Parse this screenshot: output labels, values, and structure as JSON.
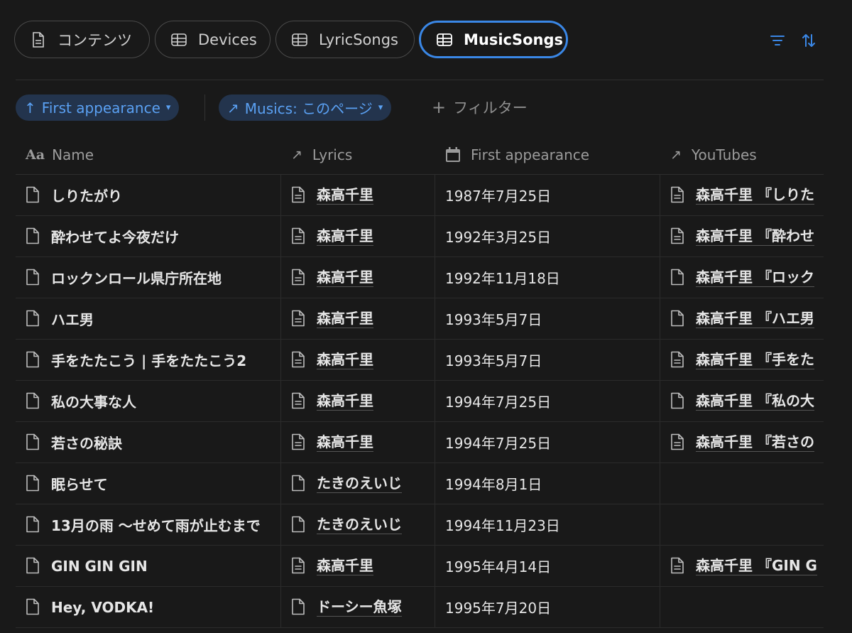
{
  "tabs": [
    {
      "label": "コンテンツ",
      "icon": "doc-icon",
      "active": false
    },
    {
      "label": "Devices",
      "icon": "table-icon",
      "active": false
    },
    {
      "label": "LyricSongs",
      "icon": "table-icon",
      "active": false
    },
    {
      "label": "MusicSongs",
      "icon": "table-icon",
      "active": true
    }
  ],
  "filters": {
    "sort_chip": {
      "arrow": "↑",
      "label": "First appearance"
    },
    "relation_chip": {
      "arrow": "↗",
      "label": "Musics: このページ"
    },
    "add_filter": {
      "plus": "+",
      "label": "フィルター"
    }
  },
  "columns": [
    {
      "label": "Name",
      "icon": "Aa"
    },
    {
      "label": "Lyrics",
      "icon": "↗"
    },
    {
      "label": "First appearance",
      "icon": "calendar-icon"
    },
    {
      "label": "YouTubes",
      "icon": "↗"
    }
  ],
  "rows": [
    {
      "name": "しりたがり",
      "lyrics": "森高千里",
      "lyrics_icon": "doc-lines",
      "date": "1987年7月25日",
      "youtube": "森高千里 『しりた",
      "yt_icon": "doc-lines"
    },
    {
      "name": "酔わせてよ今夜だけ",
      "lyrics": "森高千里",
      "lyrics_icon": "doc-lines",
      "date": "1992年3月25日",
      "youtube": "森高千里 『酔わせ",
      "yt_icon": "doc-lines"
    },
    {
      "name": "ロックンロール県庁所在地",
      "lyrics": "森高千里",
      "lyrics_icon": "doc-lines",
      "date": "1992年11月18日",
      "youtube": "森高千里 『ロック",
      "yt_icon": "doc-blank"
    },
    {
      "name": "ハエ男",
      "lyrics": "森高千里",
      "lyrics_icon": "doc-lines",
      "date": "1993年5月7日",
      "youtube": "森高千里 『ハエ男",
      "yt_icon": "doc-blank"
    },
    {
      "name": "手をたたこう | 手をたたこう2",
      "lyrics": "森高千里",
      "lyrics_icon": "doc-lines",
      "date": "1993年5月7日",
      "youtube": "森高千里 『手をた",
      "yt_icon": "doc-lines"
    },
    {
      "name": "私の大事な人",
      "lyrics": "森高千里",
      "lyrics_icon": "doc-lines",
      "date": "1994年7月25日",
      "youtube": "森高千里 『私の大",
      "yt_icon": "doc-blank"
    },
    {
      "name": "若さの秘訣",
      "lyrics": "森高千里",
      "lyrics_icon": "doc-lines",
      "date": "1994年7月25日",
      "youtube": "森高千里 『若さの",
      "yt_icon": "doc-lines"
    },
    {
      "name": "眠らせて",
      "lyrics": "たきのえいじ",
      "lyrics_icon": "doc-blank",
      "date": "1994年8月1日",
      "youtube": "",
      "yt_icon": ""
    },
    {
      "name": "13月の雨 〜せめて雨が止むまで",
      "lyrics": "たきのえいじ",
      "lyrics_icon": "doc-blank",
      "date": "1994年11月23日",
      "youtube": "",
      "yt_icon": ""
    },
    {
      "name": "GIN GIN GIN",
      "lyrics": "森高千里",
      "lyrics_icon": "doc-lines",
      "date": "1995年4月14日",
      "youtube": "森高千里 『GIN G",
      "yt_icon": "doc-lines"
    },
    {
      "name": "Hey, VODKA!",
      "lyrics": "ドーシー魚塚",
      "lyrics_icon": "doc-blank",
      "date": "1995年7月20日",
      "youtube": "",
      "yt_icon": ""
    }
  ],
  "colors": {
    "accent": "#3a87e6",
    "chip_bg": "#23344d",
    "chip_text": "#5aa0f2",
    "background": "#191919"
  }
}
